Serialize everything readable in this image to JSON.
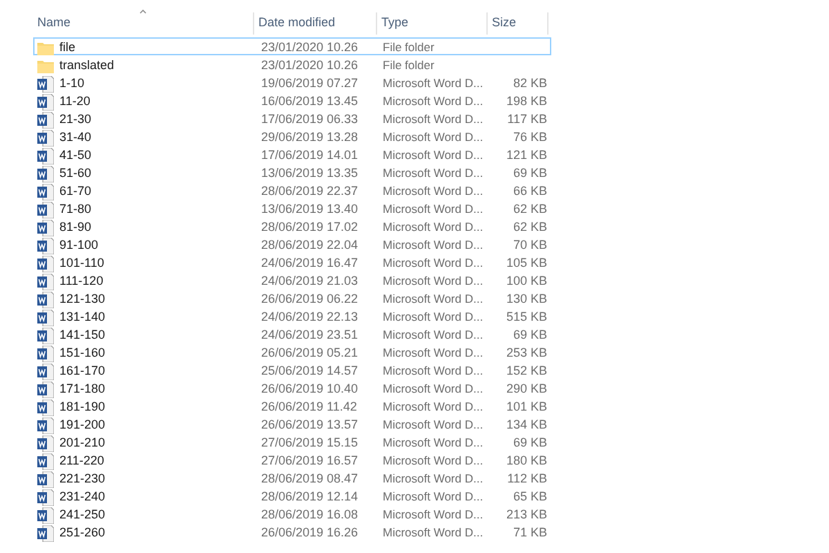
{
  "columns": [
    {
      "label": "Name",
      "sorted": true
    },
    {
      "label": "Date modified",
      "sorted": false
    },
    {
      "label": "Type",
      "sorted": false
    },
    {
      "label": "Size",
      "sorted": false
    }
  ],
  "rows": [
    {
      "kind": "folder",
      "name": "file",
      "date": "23/01/2020 10.26",
      "type": "File folder",
      "focused": true
    },
    {
      "kind": "folder",
      "name": "translated",
      "date": "23/01/2020 10.26",
      "type": "File folder",
      "focused": false
    },
    {
      "kind": "word",
      "name": "1-10",
      "date": "19/06/2019 07.27",
      "type": "Microsoft Word D...",
      "size": "82 KB",
      "focused": false
    },
    {
      "kind": "word",
      "name": "11-20",
      "date": "16/06/2019 13.45",
      "type": "Microsoft Word D...",
      "size": "198 KB",
      "focused": false
    },
    {
      "kind": "word",
      "name": "21-30",
      "date": "17/06/2019 06.33",
      "type": "Microsoft Word D...",
      "size": "117 KB",
      "focused": false
    },
    {
      "kind": "word",
      "name": "31-40",
      "date": "29/06/2019 13.28",
      "type": "Microsoft Word D...",
      "size": "76 KB",
      "focused": false
    },
    {
      "kind": "word",
      "name": "41-50",
      "date": "17/06/2019 14.01",
      "type": "Microsoft Word D...",
      "size": "121 KB",
      "focused": false
    },
    {
      "kind": "word",
      "name": "51-60",
      "date": "13/06/2019 13.35",
      "type": "Microsoft Word D...",
      "size": "69 KB",
      "focused": false
    },
    {
      "kind": "word",
      "name": "61-70",
      "date": "28/06/2019 22.37",
      "type": "Microsoft Word D...",
      "size": "66 KB",
      "focused": false
    },
    {
      "kind": "word",
      "name": "71-80",
      "date": "13/06/2019 13.40",
      "type": "Microsoft Word D...",
      "size": "62 KB",
      "focused": false
    },
    {
      "kind": "word",
      "name": "81-90",
      "date": "28/06/2019 17.02",
      "type": "Microsoft Word D...",
      "size": "62 KB",
      "focused": false
    },
    {
      "kind": "word",
      "name": "91-100",
      "date": "28/06/2019 22.04",
      "type": "Microsoft Word D...",
      "size": "70 KB",
      "focused": false
    },
    {
      "kind": "word",
      "name": "101-110",
      "date": "24/06/2019 16.47",
      "type": "Microsoft Word D...",
      "size": "105 KB",
      "focused": false
    },
    {
      "kind": "word",
      "name": "111-120",
      "date": "24/06/2019 21.03",
      "type": "Microsoft Word D...",
      "size": "100 KB",
      "focused": false
    },
    {
      "kind": "word",
      "name": "121-130",
      "date": "26/06/2019 06.22",
      "type": "Microsoft Word D...",
      "size": "130 KB",
      "focused": false
    },
    {
      "kind": "word",
      "name": "131-140",
      "date": "24/06/2019 22.13",
      "type": "Microsoft Word D...",
      "size": "515 KB",
      "focused": false
    },
    {
      "kind": "word",
      "name": "141-150",
      "date": "24/06/2019 23.51",
      "type": "Microsoft Word D...",
      "size": "69 KB",
      "focused": false
    },
    {
      "kind": "word",
      "name": "151-160",
      "date": "26/06/2019 05.21",
      "type": "Microsoft Word D...",
      "size": "253 KB",
      "focused": false
    },
    {
      "kind": "word",
      "name": "161-170",
      "date": "25/06/2019 14.57",
      "type": "Microsoft Word D...",
      "size": "152 KB",
      "focused": false
    },
    {
      "kind": "word",
      "name": "171-180",
      "date": "26/06/2019 10.40",
      "type": "Microsoft Word D...",
      "size": "290 KB",
      "focused": false
    },
    {
      "kind": "word",
      "name": "181-190",
      "date": "26/06/2019 11.42",
      "type": "Microsoft Word D...",
      "size": "101 KB",
      "focused": false
    },
    {
      "kind": "word",
      "name": "191-200",
      "date": "26/06/2019 13.57",
      "type": "Microsoft Word D...",
      "size": "134 KB",
      "focused": false
    },
    {
      "kind": "word",
      "name": "201-210",
      "date": "27/06/2019 15.15",
      "type": "Microsoft Word D...",
      "size": "69 KB",
      "focused": false
    },
    {
      "kind": "word",
      "name": "211-220",
      "date": "27/06/2019 16.57",
      "type": "Microsoft Word D...",
      "size": "180 KB",
      "focused": false
    },
    {
      "kind": "word",
      "name": "221-230",
      "date": "28/06/2019 08.47",
      "type": "Microsoft Word D...",
      "size": "112 KB",
      "focused": false
    },
    {
      "kind": "word",
      "name": "231-240",
      "date": "28/06/2019 12.14",
      "type": "Microsoft Word D...",
      "size": "65 KB",
      "focused": false
    },
    {
      "kind": "word",
      "name": "241-250",
      "date": "28/06/2019 16.08",
      "type": "Microsoft Word D...",
      "size": "213 KB",
      "focused": false
    },
    {
      "kind": "word",
      "name": "251-260",
      "date": "26/06/2019 16.26",
      "type": "Microsoft Word D...",
      "size": "71 KB",
      "focused": false
    }
  ]
}
